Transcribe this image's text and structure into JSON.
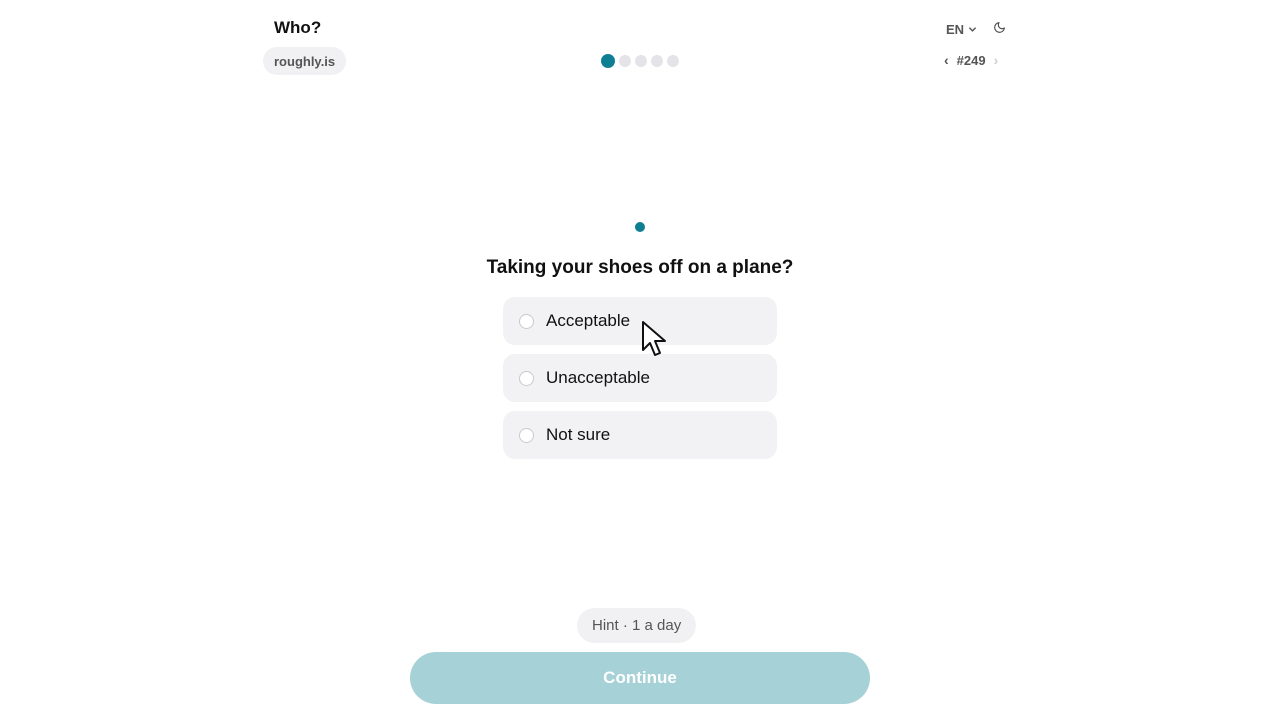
{
  "header": {
    "title": "Who?",
    "brand": "roughly.is",
    "language": "EN",
    "puzzle_number": "#249",
    "progress": {
      "total": 5,
      "current": 1
    }
  },
  "question": {
    "text": "Taking your shoes off on a plane?",
    "options": [
      {
        "label": "Acceptable"
      },
      {
        "label": "Unacceptable"
      },
      {
        "label": "Not sure"
      }
    ]
  },
  "footer": {
    "hint_label": "Hint · 1 a day",
    "continue_label": "Continue"
  },
  "colors": {
    "accent": "#0e7e93",
    "continue_disabled": "#a6d1d7",
    "option_bg": "#f2f2f4"
  }
}
